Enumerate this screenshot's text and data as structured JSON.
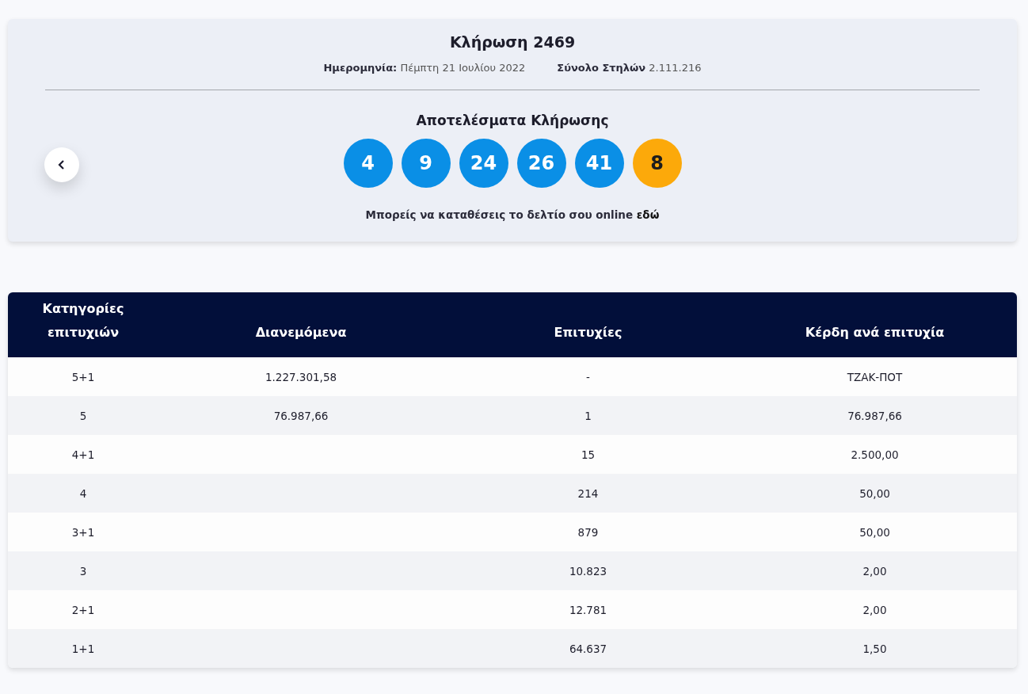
{
  "draw": {
    "title": "Κλήρωση 2469",
    "date_label": "Ημερομηνία:",
    "date_value": "Πέμπτη 21 Ιουλίου 2022",
    "columns_label": "Σύνολο Στηλών",
    "columns_value": "2.111.216"
  },
  "results": {
    "title": "Αποτελέσματα Κλήρωσης",
    "balls": [
      {
        "number": "4",
        "kind": "main"
      },
      {
        "number": "9",
        "kind": "main"
      },
      {
        "number": "24",
        "kind": "main"
      },
      {
        "number": "26",
        "kind": "main"
      },
      {
        "number": "41",
        "kind": "main"
      },
      {
        "number": "8",
        "kind": "bonus"
      }
    ],
    "note": "Μπορείς να καταθέσεις το δελτίο σου online",
    "note_link": "εδώ"
  },
  "table": {
    "columns": [
      "Κατηγορίες επιτυχιών",
      "Διανεμόμενα",
      "Επιτυχίες",
      "Κέρδη ανά επιτυχία"
    ],
    "rows": [
      [
        "5+1",
        "1.227.301,58",
        "-",
        "ΤΖΑΚ-ΠΟΤ"
      ],
      [
        "5",
        "76.987,66",
        "1",
        "76.987,66"
      ],
      [
        "4+1",
        "",
        "15",
        "2.500,00"
      ],
      [
        "4",
        "",
        "214",
        "50,00"
      ],
      [
        "3+1",
        "",
        "879",
        "50,00"
      ],
      [
        "3",
        "",
        "10.823",
        "2,00"
      ],
      [
        "2+1",
        "",
        "12.781",
        "2,00"
      ],
      [
        "1+1",
        "",
        "64.637",
        "1,50"
      ]
    ]
  }
}
